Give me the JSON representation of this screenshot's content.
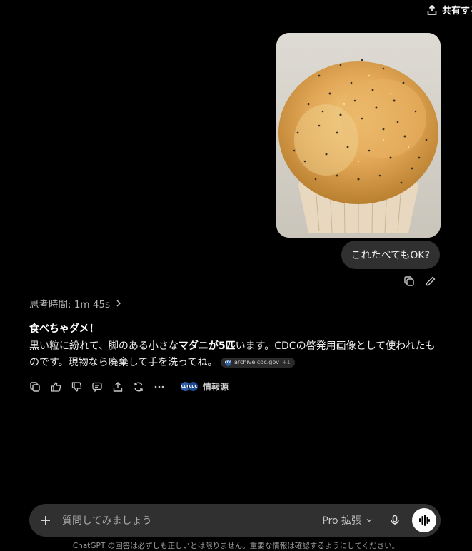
{
  "header": {
    "share_label": "共有する"
  },
  "user_message": {
    "text": "これたべてもOK?"
  },
  "assistant": {
    "thinking_label": "思考時間: 1m 45s",
    "heading": "食べちゃダメ！",
    "line1_prefix": "黒い粒に紛れて、脚のある小さな",
    "line1_bold": "マダニが5匹",
    "line1_suffix": "います。CDCの啓発用画像として使われたものです。現物なら廃棄して手を洗ってね。",
    "citation": {
      "source": "archive.cdc.gov",
      "extra": "+1"
    },
    "sources_label": "情報源"
  },
  "composer": {
    "placeholder": "質問してみましょう",
    "model_label": "Pro 拡張"
  },
  "footer": {
    "disclaimer": "ChatGPT の回答は必ずしも正しいとは限りません。重要な情報は確認するようにしてください。"
  },
  "icons": [
    "share-icon",
    "copy-icon",
    "edit-icon",
    "chevron-right-icon",
    "thumbs-up-icon",
    "thumbs-down-icon",
    "comment-icon",
    "share-icon",
    "regenerate-icon",
    "more-icon",
    "plus-icon",
    "chevron-down-icon",
    "mic-icon",
    "voice-wave-icon"
  ]
}
